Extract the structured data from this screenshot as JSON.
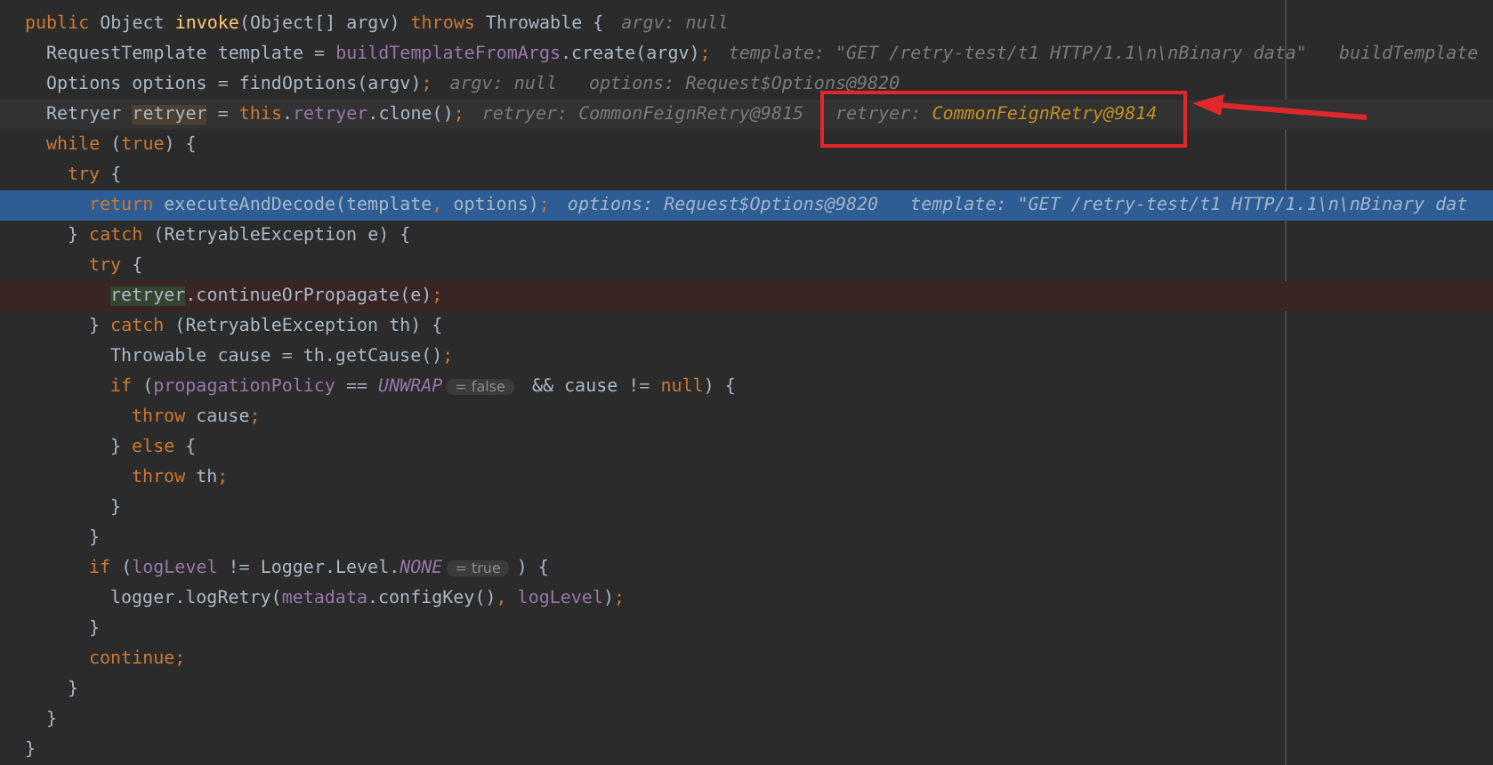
{
  "editor": {
    "lines": [
      {
        "kind": "normal",
        "tokens": [
          {
            "text": "public ",
            "kind": "kw"
          },
          {
            "text": "Object ",
            "kind": "plain"
          },
          {
            "text": "invoke",
            "kind": "method"
          },
          {
            "text": "(Object[] argv) ",
            "kind": "plain"
          },
          {
            "text": "throws ",
            "kind": "kw"
          },
          {
            "text": "Throwable {",
            "kind": "plain"
          }
        ],
        "hints": [
          {
            "name": "argv:",
            "value": "null",
            "changed": false,
            "annotated": false
          }
        ],
        "children": [
          {
            "kind": "normal",
            "tokens": [
              {
                "text": "RequestTemplate template = ",
                "kind": "plain"
              },
              {
                "text": "buildTemplateFromArgs",
                "kind": "field"
              },
              {
                "text": ".create(argv)",
                "kind": "plain"
              },
              {
                "text": ";",
                "kind": "kw"
              }
            ],
            "hints": [
              {
                "name": "template:",
                "value": "\"GET /retry-test/t1 HTTP/1.1\\n\\nBinary data\"",
                "changed": false,
                "annotated": false
              },
              {
                "name": "buildTemplate",
                "changed": false,
                "annotated": false
              }
            ]
          },
          {
            "kind": "normal",
            "tokens": [
              {
                "text": "Options options = findOptions(argv)",
                "kind": "plain"
              },
              {
                "text": ";",
                "kind": "kw"
              }
            ],
            "hints": [
              {
                "name": "argv:",
                "value": "null",
                "changed": false,
                "annotated": false
              },
              {
                "name": "options:",
                "value": "Request$Options@9820",
                "changed": false,
                "annotated": false
              }
            ]
          },
          {
            "kind": "caret",
            "tokens": [
              {
                "text": "Retryer ",
                "kind": "plain"
              },
              {
                "text": "retryer",
                "kind": "decl"
              },
              {
                "text": " = ",
                "kind": "plain"
              },
              {
                "text": "this",
                "kind": "kw"
              },
              {
                "text": ".",
                "kind": "plain"
              },
              {
                "text": "retryer",
                "kind": "field"
              },
              {
                "text": ".clone()",
                "kind": "plain"
              },
              {
                "text": ";",
                "kind": "kw"
              }
            ],
            "hints": [
              {
                "name": "retryer:",
                "value": "CommonFeignRetry@9815",
                "changed": false,
                "annotated": false
              },
              {
                "name": "retryer:",
                "value": "CommonFeignRetry@9814",
                "changed": true,
                "annotated": true
              }
            ]
          },
          {
            "kind": "normal",
            "tokens": [
              {
                "text": "while ",
                "kind": "kw"
              },
              {
                "text": "(",
                "kind": "plain"
              },
              {
                "text": "true",
                "kind": "kw"
              },
              {
                "text": ") {",
                "kind": "plain"
              }
            ],
            "children": [
              {
                "kind": "normal",
                "tokens": [
                  {
                    "text": "try ",
                    "kind": "kw"
                  },
                  {
                    "text": "{",
                    "kind": "plain"
                  }
                ],
                "children": [
                  {
                    "kind": "execution",
                    "tokens": [
                      {
                        "text": "return ",
                        "kind": "kw"
                      },
                      {
                        "text": "executeAndDecode(template",
                        "kind": "plain"
                      },
                      {
                        "text": ", ",
                        "kind": "kw"
                      },
                      {
                        "text": "options)",
                        "kind": "plain"
                      },
                      {
                        "text": ";",
                        "kind": "kw"
                      }
                    ],
                    "hints": [
                      {
                        "name": "options:",
                        "value": "Request$Options@9820",
                        "changed": false,
                        "annotated": false
                      },
                      {
                        "name": "template:",
                        "value": "\"GET /retry-test/t1 HTTP/1.1\\n\\nBinary dat",
                        "changed": false,
                        "annotated": false
                      }
                    ]
                  }
                ]
              },
              {
                "kind": "normal",
                "tokens": [
                  {
                    "text": "} ",
                    "kind": "plain"
                  },
                  {
                    "text": "catch ",
                    "kind": "kw"
                  },
                  {
                    "text": "(RetryableException e) {",
                    "kind": "plain"
                  }
                ],
                "children": [
                  {
                    "kind": "normal",
                    "tokens": [
                      {
                        "text": "try ",
                        "kind": "kw"
                      },
                      {
                        "text": "{",
                        "kind": "plain"
                      }
                    ],
                    "children": [
                      {
                        "kind": "breakpoint",
                        "tokens": [
                          {
                            "text": "retryer",
                            "kind": "use"
                          },
                          {
                            "text": ".continueOrPropagate(e)",
                            "kind": "plain"
                          },
                          {
                            "text": ";",
                            "kind": "kw"
                          }
                        ]
                      }
                    ]
                  },
                  {
                    "kind": "normal",
                    "tokens": [
                      {
                        "text": "} ",
                        "kind": "plain"
                      },
                      {
                        "text": "catch ",
                        "kind": "kw"
                      },
                      {
                        "text": "(RetryableException th) {",
                        "kind": "plain"
                      }
                    ],
                    "children": [
                      {
                        "kind": "normal",
                        "tokens": [
                          {
                            "text": "Throwable cause = th.getCause()",
                            "kind": "plain"
                          },
                          {
                            "text": ";",
                            "kind": "kw"
                          }
                        ]
                      },
                      {
                        "kind": "normal",
                        "tokens": [
                          {
                            "text": "if ",
                            "kind": "kw"
                          },
                          {
                            "text": "(",
                            "kind": "plain"
                          },
                          {
                            "text": "propagationPolicy",
                            "kind": "field"
                          },
                          {
                            "text": " == ",
                            "kind": "plain"
                          },
                          {
                            "text": "UNWRAP",
                            "kind": "const"
                          },
                          {
                            "text": "= false",
                            "kind": "badge"
                          },
                          {
                            "text": " && cause != ",
                            "kind": "plain"
                          },
                          {
                            "text": "null",
                            "kind": "kw"
                          },
                          {
                            "text": ") {",
                            "kind": "plain"
                          }
                        ],
                        "children": [
                          {
                            "kind": "normal",
                            "tokens": [
                              {
                                "text": "throw ",
                                "kind": "kw"
                              },
                              {
                                "text": "cause",
                                "kind": "plain"
                              },
                              {
                                "text": ";",
                                "kind": "kw"
                              }
                            ]
                          }
                        ]
                      },
                      {
                        "kind": "normal",
                        "tokens": [
                          {
                            "text": "} ",
                            "kind": "plain"
                          },
                          {
                            "text": "else ",
                            "kind": "kw"
                          },
                          {
                            "text": "{",
                            "kind": "plain"
                          }
                        ],
                        "children": [
                          {
                            "kind": "normal",
                            "tokens": [
                              {
                                "text": "throw ",
                                "kind": "kw"
                              },
                              {
                                "text": "th",
                                "kind": "plain"
                              },
                              {
                                "text": ";",
                                "kind": "kw"
                              }
                            ]
                          }
                        ]
                      },
                      {
                        "kind": "normal",
                        "tokens": [
                          {
                            "text": "}",
                            "kind": "plain"
                          }
                        ]
                      }
                    ]
                  },
                  {
                    "kind": "normal",
                    "tokens": [
                      {
                        "text": "}",
                        "kind": "plain"
                      }
                    ]
                  },
                  {
                    "kind": "normal",
                    "tokens": [
                      {
                        "text": "if ",
                        "kind": "kw"
                      },
                      {
                        "text": "(",
                        "kind": "plain"
                      },
                      {
                        "text": "logLevel",
                        "kind": "field"
                      },
                      {
                        "text": " != Logger.Level.",
                        "kind": "plain"
                      },
                      {
                        "text": "NONE",
                        "kind": "const"
                      },
                      {
                        "text": "= true",
                        "kind": "badge"
                      },
                      {
                        "text": ") {",
                        "kind": "plain"
                      }
                    ],
                    "children": [
                      {
                        "kind": "normal",
                        "tokens": [
                          {
                            "text": "logger.logRetry(",
                            "kind": "plain"
                          },
                          {
                            "text": "metadata",
                            "kind": "field"
                          },
                          {
                            "text": ".configKey()",
                            "kind": "plain"
                          },
                          {
                            "text": ", ",
                            "kind": "kw"
                          },
                          {
                            "text": "logLevel",
                            "kind": "field"
                          },
                          {
                            "text": ")",
                            "kind": "plain"
                          },
                          {
                            "text": ";",
                            "kind": "kw"
                          }
                        ]
                      }
                    ]
                  },
                  {
                    "kind": "normal",
                    "tokens": [
                      {
                        "text": "}",
                        "kind": "plain"
                      }
                    ]
                  },
                  {
                    "kind": "normal",
                    "tokens": [
                      {
                        "text": "continue",
                        "kind": "kw"
                      },
                      {
                        "text": ";",
                        "kind": "kw"
                      }
                    ]
                  }
                ]
              },
              {
                "kind": "normal",
                "tokens": [
                  {
                    "text": "}",
                    "kind": "plain"
                  }
                ]
              }
            ]
          },
          {
            "kind": "normal",
            "tokens": [
              {
                "text": "}",
                "kind": "plain"
              }
            ]
          }
        ]
      },
      {
        "kind": "normal",
        "tokens": [
          {
            "text": "}",
            "kind": "plain"
          }
        ]
      }
    ]
  }
}
